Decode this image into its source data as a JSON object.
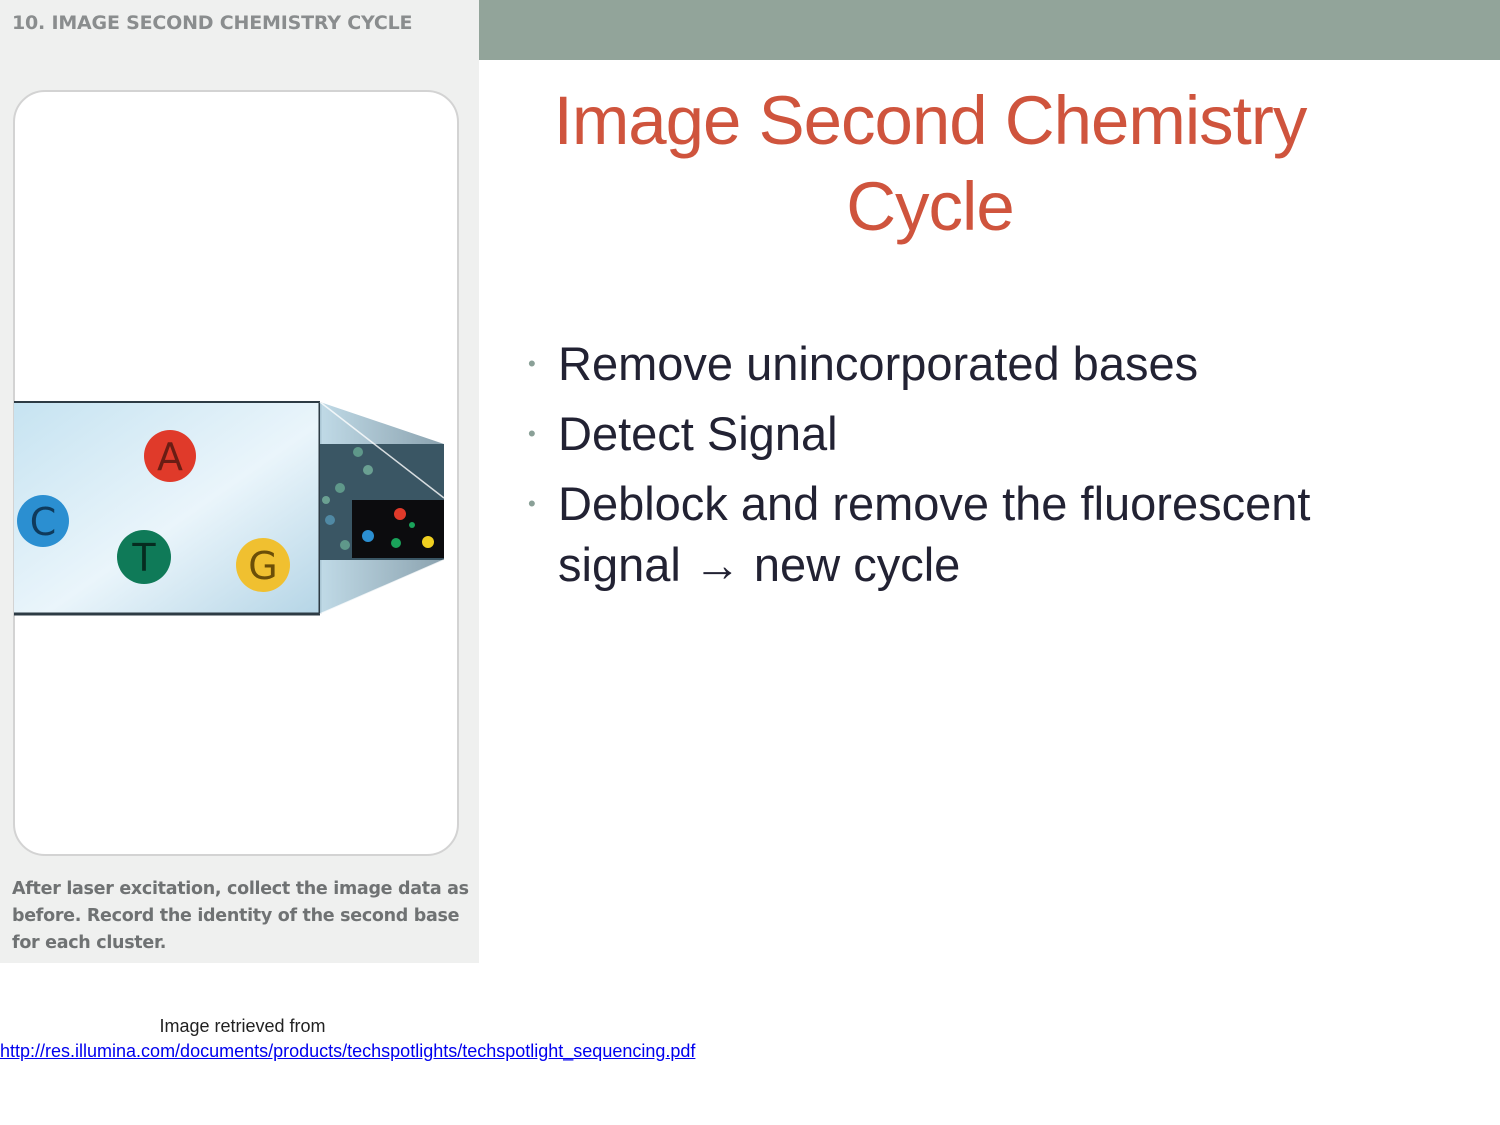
{
  "slide": {
    "title": "Image Second Chemistry Cycle",
    "bullets": [
      "Remove unincorporated bases",
      "Detect Signal",
      "Deblock and remove the fluorescent signal → new cycle"
    ]
  },
  "figure": {
    "heading": "10. IMAGE SECOND CHEMISTRY CYCLE",
    "bases": [
      "A",
      "C",
      "T",
      "G"
    ],
    "caption": "After laser excitation, collect the image data as before. Record the identity of the second base for each cluster.",
    "colors": {
      "A": "#e03a2a",
      "C": "#2b8fd1",
      "T": "#0f7a58",
      "G": "#f0c030",
      "top_bar": "#92a49a",
      "title": "#cf543d"
    }
  },
  "credit": {
    "prefix": "Image retrieved from",
    "link_text": "http://res.illumina.com/documents/products/techspotlights/techspotlight_sequencing.pdf"
  }
}
